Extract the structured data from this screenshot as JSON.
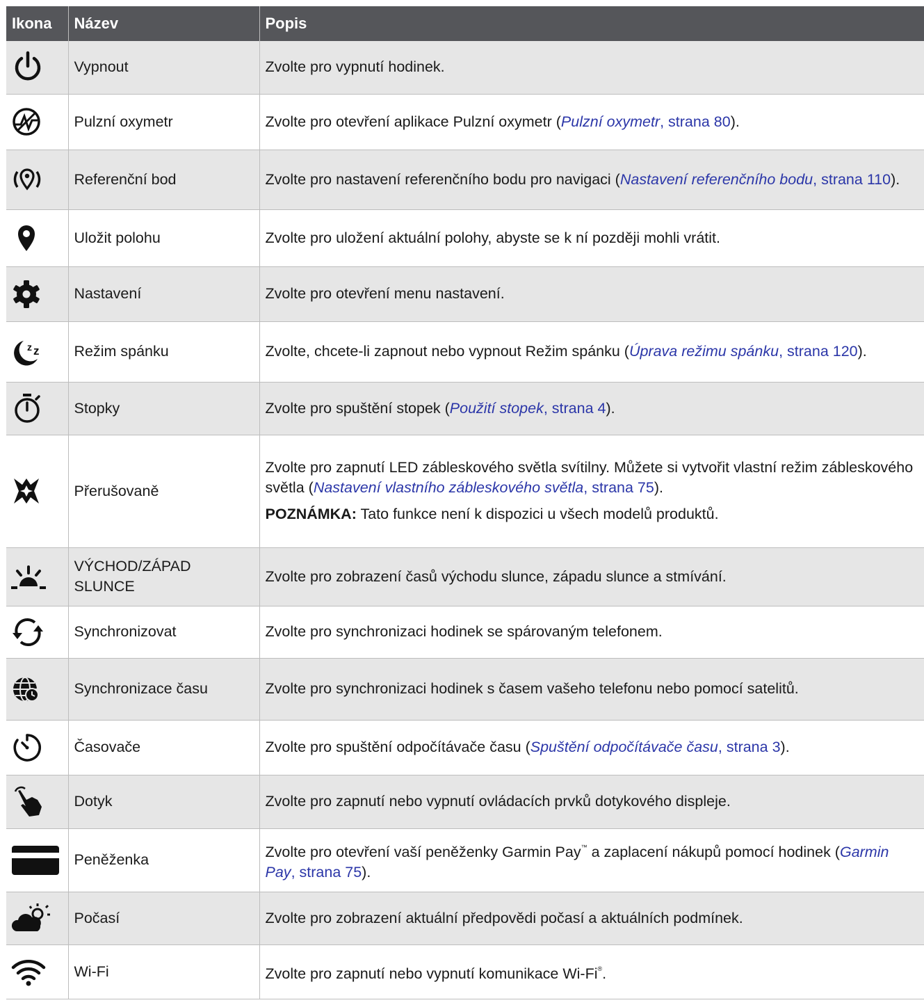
{
  "headers": {
    "icon": "Ikona",
    "name": "Název",
    "desc": "Popis"
  },
  "rows": [
    {
      "icon": "power-icon",
      "name": "Vypnout",
      "desc": "Zvolte pro vypnutí hodinek."
    },
    {
      "icon": "pulse-ox-icon",
      "name": "Pulzní oxymetr",
      "desc": "Zvolte pro otevření aplikace Pulzní oxymetr (",
      "ref": "Pulzní oxymetr",
      "page": "strana 80",
      "after": ")."
    },
    {
      "icon": "reference-point-icon",
      "name": "Referenční bod",
      "desc": "Zvolte pro nastavení referenčního bodu pro navigaci (",
      "ref": "Nastavení referenčního bodu",
      "page": "strana 110",
      "after": ")."
    },
    {
      "icon": "location-pin-icon",
      "name": "Uložit polohu",
      "desc": "Zvolte pro uložení aktuální polohy, abyste se k ní později mohli vrátit."
    },
    {
      "icon": "gear-icon",
      "name": "Nastavení",
      "desc": "Zvolte pro otevření menu nastavení."
    },
    {
      "icon": "sleep-moon-icon",
      "name": "Režim spánku",
      "desc": "Zvolte, chcete-li zapnout nebo vypnout Režim spánku (",
      "ref": "Úprava režimu spánku",
      "page": "strana 120",
      "after": ")."
    },
    {
      "icon": "stopwatch-icon",
      "name": "Stopky",
      "desc": "Zvolte pro spuštění stopek (",
      "ref": "Použití stopek",
      "page": "strana 4",
      "after": ")."
    },
    {
      "icon": "strobe-icon",
      "name": "Přerušovaně",
      "desc": "Zvolte pro zapnutí LED zábleskového světla svítilny. Můžete si vytvořit vlastní režim zábleskového světla (",
      "ref": "Nastavení vlastního zábleskového světla",
      "page": "strana 75",
      "after": ").",
      "note_label": "POZNÁMKA:",
      "note_text": " Tato funkce není k dispozici u všech modelů produktů."
    },
    {
      "icon": "sunrise-icon",
      "name": "VÝCHOD/ZÁPAD SLUNCE",
      "desc": "Zvolte pro zobrazení časů východu slunce, západu slunce a stmívání."
    },
    {
      "icon": "sync-icon",
      "name": "Synchronizovat",
      "desc": "Zvolte pro synchronizaci hodinek se spárovaným telefonem."
    },
    {
      "icon": "time-sync-globe-icon",
      "name": "Synchronizace času",
      "desc": "Zvolte pro synchronizaci hodinek s časem vašeho telefonu nebo pomocí satelitů."
    },
    {
      "icon": "timer-icon",
      "name": "Časovače",
      "desc": "Zvolte pro spuštění odpočítávače času (",
      "ref": "Spuštění odpočítávače času",
      "page": "strana 3",
      "after": ")."
    },
    {
      "icon": "touch-hand-icon",
      "name": "Dotyk",
      "desc": "Zvolte pro zapnutí nebo vypnutí ovládacích prvků dotykového displeje."
    },
    {
      "icon": "wallet-card-icon",
      "name": "Peněženka",
      "desc": "Zvolte pro otevření vaší peněženky Garmin Pay",
      "tm": "™",
      "desc2": " a zaplacení nákupů pomocí hodinek (",
      "ref": "Garmin Pay",
      "page": "strana 75",
      "after": ")."
    },
    {
      "icon": "weather-icon",
      "name": "Počasí",
      "desc": "Zvolte pro zobrazení aktuální předpovědi počasí a aktuálních podmínek."
    },
    {
      "icon": "wifi-icon",
      "name": "Wi-Fi",
      "desc": "Zvolte pro zapnutí nebo vypnutí komunikace Wi-Fi",
      "reg": "®",
      "after": "."
    }
  ]
}
